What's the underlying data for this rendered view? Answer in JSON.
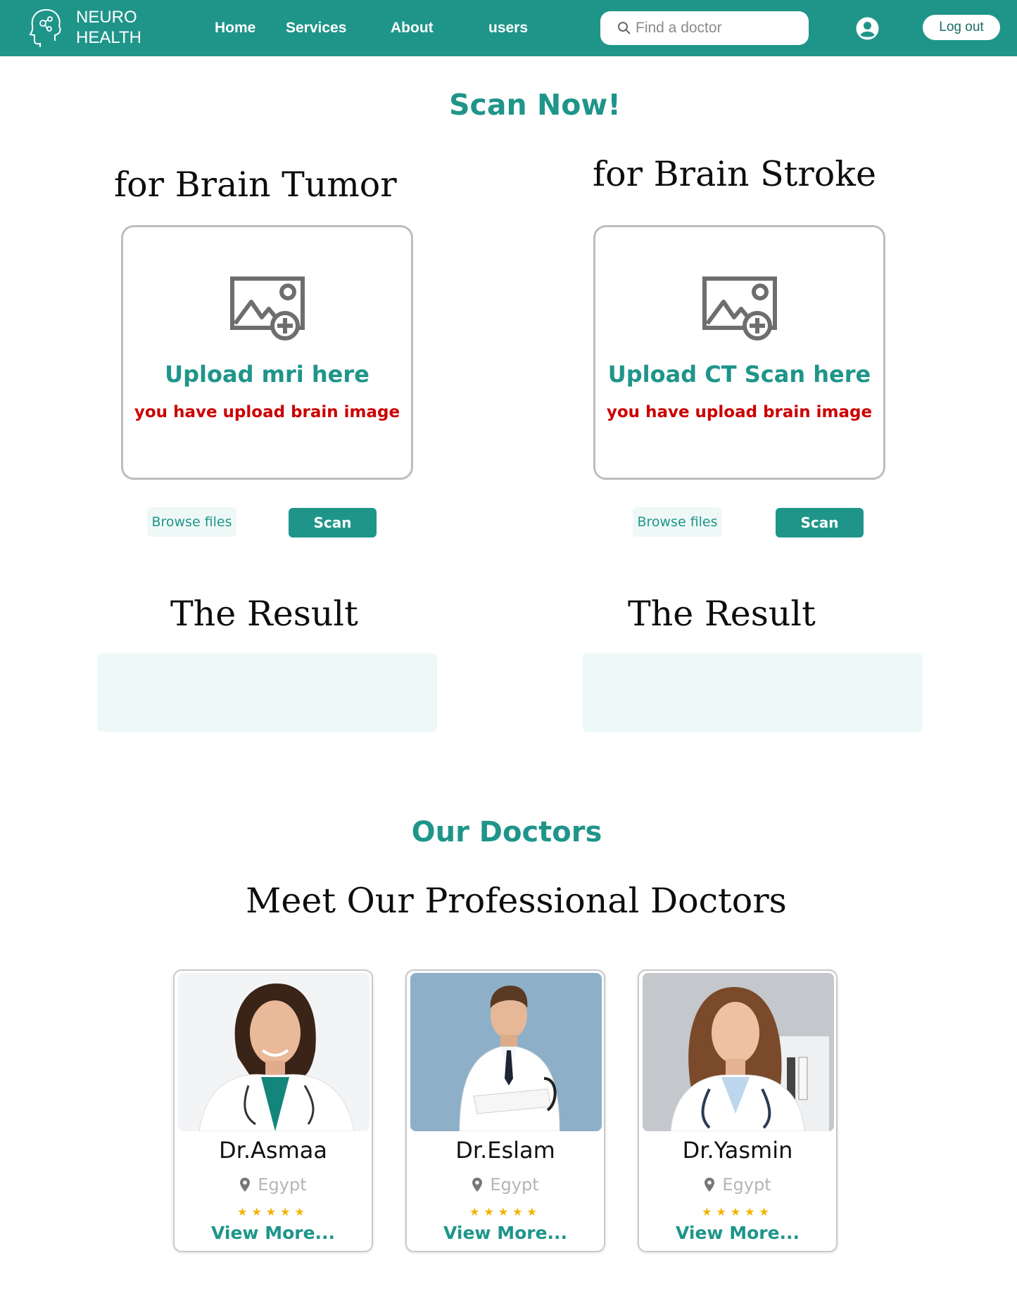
{
  "brand": {
    "line1": "NEURO",
    "line2": "HEALTH",
    "icon": "brain-head-icon"
  },
  "nav": {
    "home": "Home",
    "services": "Services",
    "about": "About",
    "users": "users"
  },
  "search": {
    "placeholder": "Find a doctor",
    "value": ""
  },
  "header": {
    "logout_label": "Log out",
    "user_icon": "user-avatar-icon"
  },
  "scan_section": {
    "title": "Scan Now!",
    "tumor": {
      "heading": "for Brain Tumor",
      "upload_title": "Upload mri here",
      "warning": "you have upload brain image",
      "browse_label": "Browse files",
      "scan_label": "Scan",
      "result_heading": "The Result",
      "result_value": ""
    },
    "stroke": {
      "heading": "for Brain Stroke",
      "upload_title": "Upload CT Scan here",
      "warning": "you have upload brain image",
      "browse_label": "Browse files",
      "scan_label": "Scan",
      "result_heading": "The Result",
      "result_value": ""
    }
  },
  "doctors_section": {
    "title": "Our Doctors",
    "subtitle": "Meet Our Professional Doctors",
    "doctors": [
      {
        "name": "Dr.Asmaa",
        "location": "Egypt",
        "stars": "★★★★★",
        "link": "View More..."
      },
      {
        "name": "Dr.Eslam",
        "location": "Egypt",
        "stars": "★★★★★",
        "link": "View More..."
      },
      {
        "name": "Dr.Yasmin",
        "location": "Egypt",
        "stars": "★★★★★",
        "link": "View More..."
      }
    ]
  },
  "colors": {
    "primary": "#1f958a",
    "warning": "#cc0000",
    "star": "#f0b400",
    "result_bg": "#edf9f8"
  }
}
